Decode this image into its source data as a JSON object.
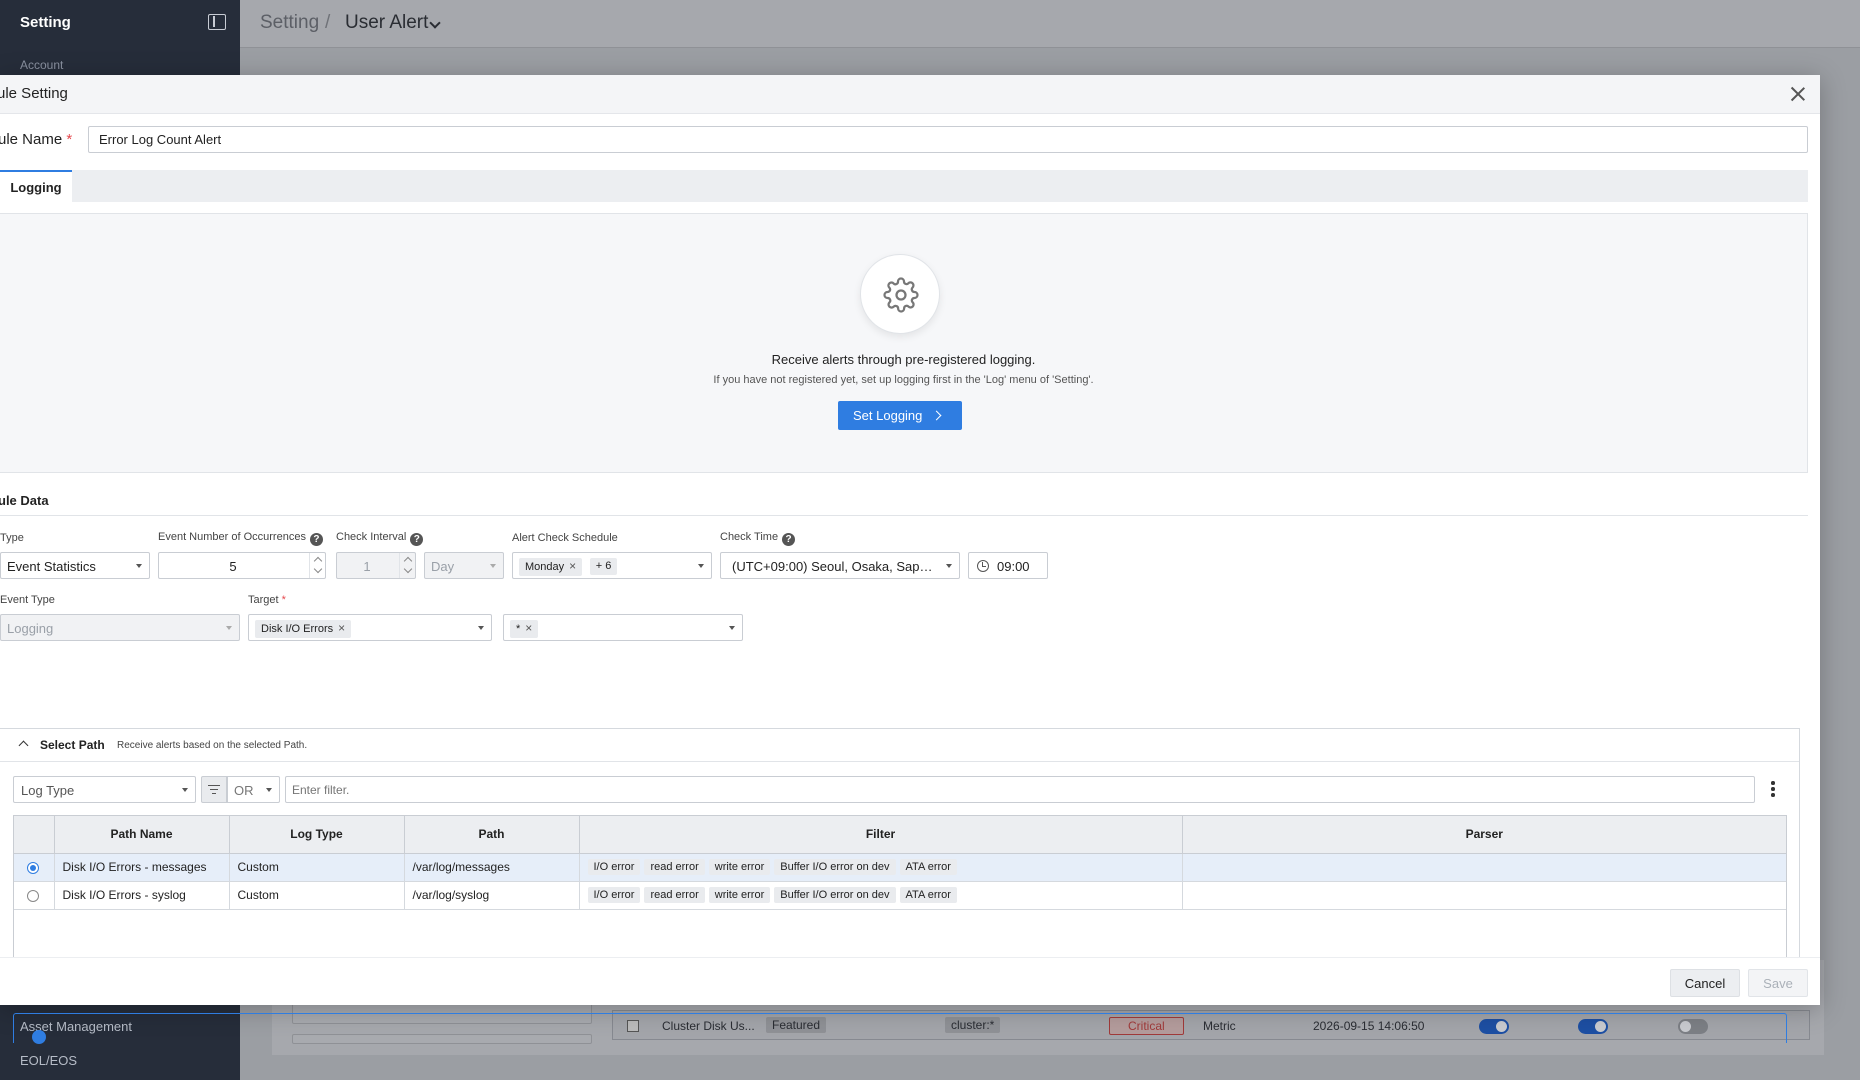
{
  "sidebar": {
    "title": "Setting",
    "items": [
      {
        "label": "Account"
      },
      {
        "label": "Asset Management"
      },
      {
        "label": "EOL/EOS"
      }
    ]
  },
  "header": {
    "breadcrumb_root": "Setting",
    "breadcrumb_sep": "/",
    "breadcrumb_current": "User Alert"
  },
  "background_row": {
    "name": "Cluster Disk Us...",
    "badge": "Featured",
    "target": "cluster:*",
    "severity": "Critical",
    "type": "Metric",
    "timestamp": "2026-09-15 14:06:50",
    "toggles": [
      true,
      true,
      false
    ]
  },
  "modal": {
    "title": "ule Setting",
    "rule_name_label": "ule Name",
    "required_mark": "*",
    "rule_name_value": "Error Log Count Alert",
    "tab": "Logging",
    "info_main": "Receive alerts through pre-registered logging.",
    "info_sub": "If you have not registered yet, set up logging first in the 'Log' menu of 'Setting'.",
    "set_logging_label": "Set Logging",
    "rule_data_title": "ule Data",
    "fields": {
      "type_label": "Type",
      "type_value": "Event Statistics",
      "occurrences_label": "Event Number of Occurrences",
      "occurrences_value": "5",
      "interval_label": "Check Interval",
      "interval_value": "1",
      "interval_unit": "Day",
      "schedule_label": "Alert Check Schedule",
      "schedule_chip": "Monday",
      "schedule_more": "+ 6",
      "check_time_label": "Check Time",
      "timezone_value": "(UTC+09:00) Seoul, Osaka, Sappor...",
      "time_value": "09:00",
      "event_type_label": "Event Type",
      "event_type_value": "Logging",
      "target_label": "Target",
      "target_chip": "Disk I/O Errors",
      "target2_chip": "*"
    },
    "path": {
      "title": "Select Path",
      "desc": "Receive alerts based on the selected Path.",
      "log_type_placeholder": "Log Type",
      "operator": "OR",
      "filter_placeholder": "Enter filter.",
      "columns": [
        "Path Name",
        "Log Type",
        "Path",
        "Filter",
        "Parser"
      ],
      "rows": [
        {
          "selected": true,
          "name": "Disk I/O Errors - messages",
          "log_type": "Custom",
          "path": "/var/log/messages",
          "filters": [
            "I/O error",
            "read error",
            "write error",
            "Buffer I/O error on dev",
            "ATA error"
          ],
          "parser": ""
        },
        {
          "selected": false,
          "name": "Disk I/O Errors - syslog",
          "log_type": "Custom",
          "path": "/var/log/syslog",
          "filters": [
            "I/O error",
            "read error",
            "write error",
            "Buffer I/O error on dev",
            "ATA error"
          ],
          "parser": ""
        }
      ]
    },
    "cancel_label": "Cancel",
    "save_label": "Save"
  }
}
